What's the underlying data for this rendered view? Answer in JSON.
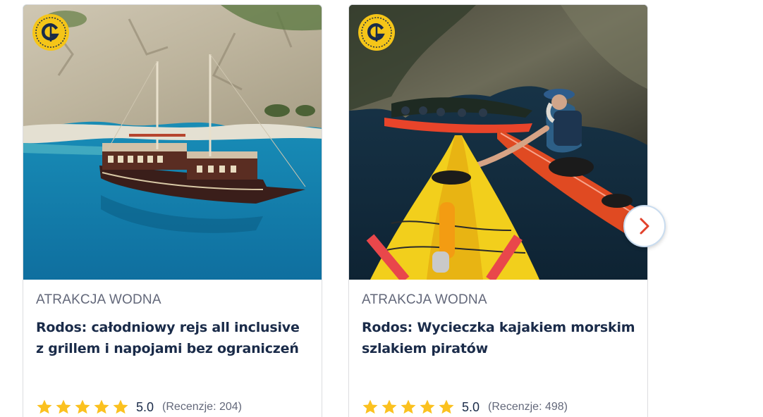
{
  "cards": [
    {
      "category": "ATRAKCJA WODNA",
      "title": "Rodos: całodniowy rejs all inclusive z grillem i napojami bez ograniczeń",
      "rating": "5.0",
      "reviews": "(Recenzje: 204)",
      "stars": 5,
      "badge_icon": "getyourguide-badge-icon",
      "image": "pirate-ship-boat-in-turquoise-bay-image"
    },
    {
      "category": "ATRAKCJA WODNA",
      "title": "Rodos: Wycieczka kajakiem morskim szlakiem piratów",
      "rating": "5.0",
      "reviews": "(Recenzje: 498)",
      "stars": 5,
      "badge_icon": "getyourguide-badge-icon",
      "image": "sea-kayaks-in-cave-image"
    }
  ],
  "colors": {
    "star": "#fbc11f",
    "title": "#1a2b49",
    "category": "#63687a",
    "badge": "#f5c518",
    "arrow": "#e2412b"
  },
  "carousel": {
    "next_icon": "chevron-right-icon"
  }
}
